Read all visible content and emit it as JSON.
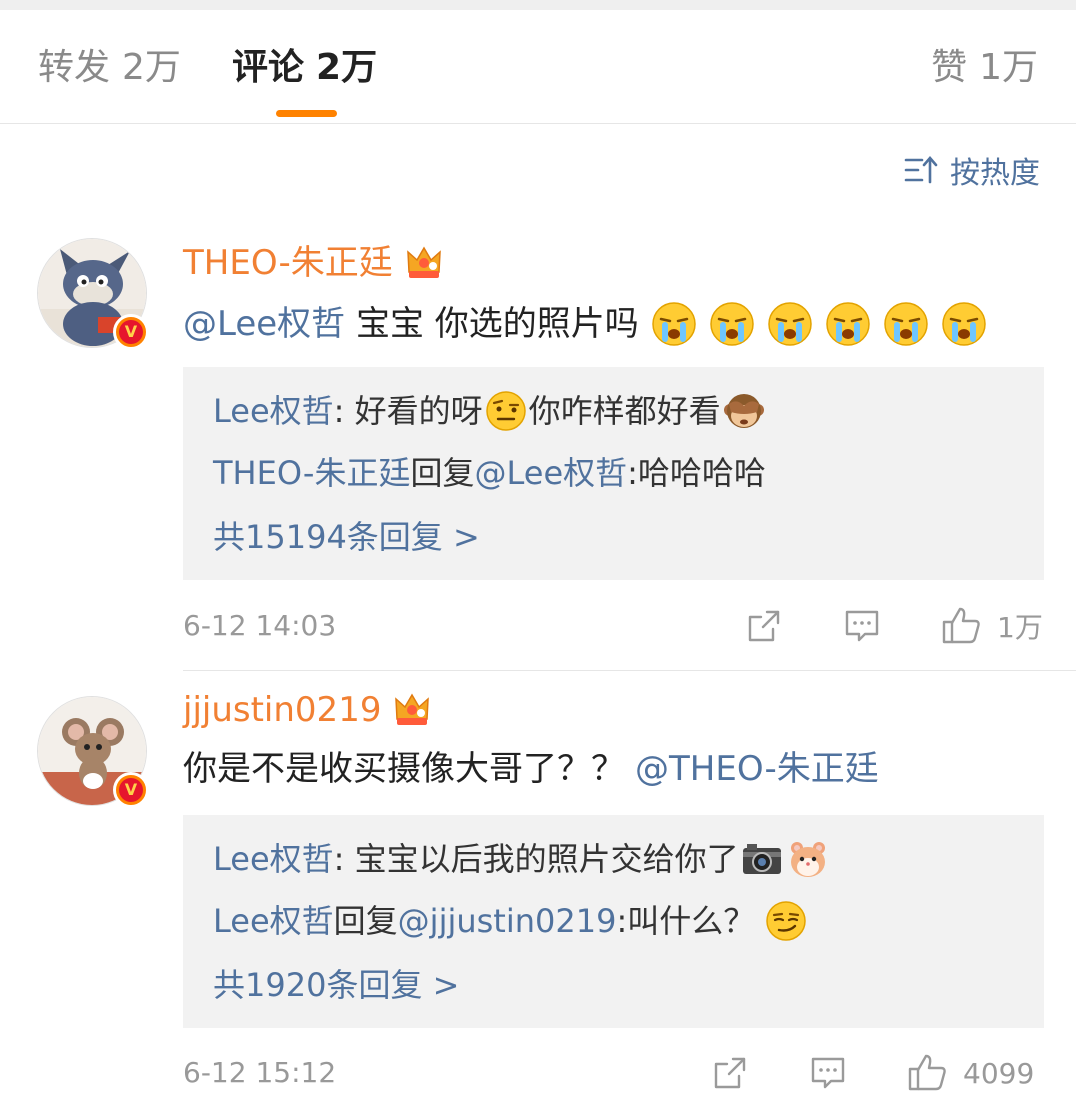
{
  "tabs": {
    "repost": {
      "label": "转发",
      "count": "2万"
    },
    "comment": {
      "label": "评论",
      "count": "2万"
    },
    "like": {
      "label": "赞",
      "count": "1万"
    }
  },
  "sort": {
    "label": "按热度",
    "icon": "sort-icon"
  },
  "accent_color": "#ff8200",
  "link_color": "#50729e",
  "username_color": "#f18033",
  "comments": [
    {
      "username": "THEO-朱正廷",
      "mention": "@Lee权哲",
      "text": " 宝宝 你选的照片吗",
      "emoji": "crying-emoji",
      "replies": [
        {
          "name": "Lee权哲",
          "sep": ": ",
          "text1": "好看的呀",
          "emoji": "raised-eyebrow-emoji",
          "text2": "你咋样都好看",
          "emoji2": "see-no-evil-monkey-emoji"
        },
        {
          "name": "THEO-朱正廷",
          "mid": "回复",
          "target": "@Lee权哲",
          "text": ":哈哈哈哈"
        }
      ],
      "total_replies": "共15194条回复 >",
      "time": "6-12 14:03",
      "likes": "1万"
    },
    {
      "username": "jjjustin0219",
      "text": "你是不是收买摄像大哥了？？",
      "mention": "@THEO-朱正廷",
      "replies": [
        {
          "name": "Lee权哲",
          "sep": ": ",
          "text1": "宝宝以后我的照片交给你了",
          "emoji": "camera-emoji",
          "emoji2": "hamster-emoji"
        },
        {
          "name": "Lee权哲",
          "mid": "回复",
          "target": "@jjjustin0219",
          "text": ":叫什么？",
          "emoji": "smirk-emoji"
        }
      ],
      "total_replies": "共1920条回复 >",
      "time": "6-12 15:12",
      "likes": "4099"
    }
  ]
}
